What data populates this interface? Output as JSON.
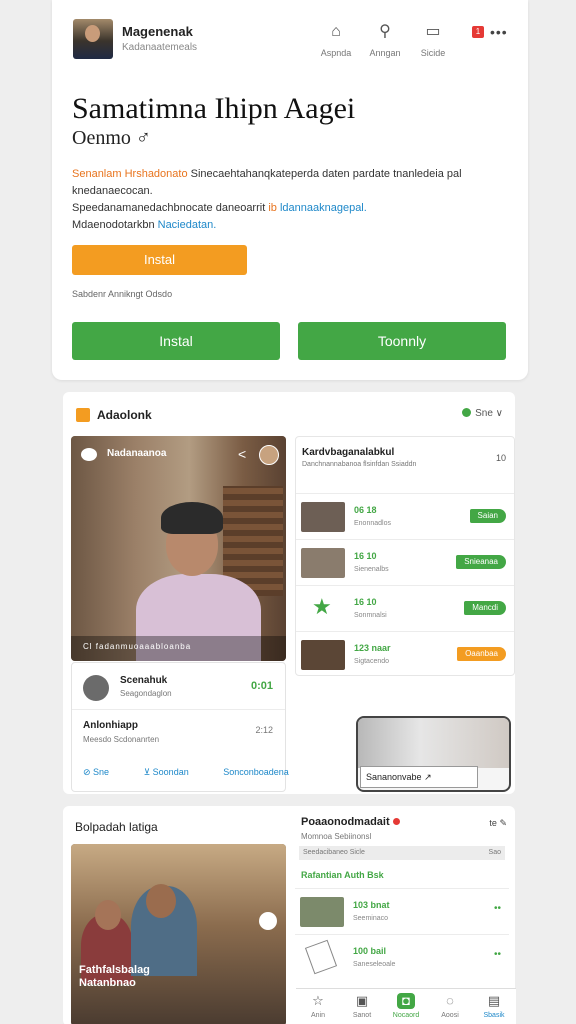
{
  "header": {
    "app_name": "Magenenak",
    "app_sub": "Kadanaatemeals",
    "actions": [
      {
        "icon": "home-icon",
        "label": "Aspnda"
      },
      {
        "icon": "bookmark-icon",
        "label": "Anngan"
      },
      {
        "icon": "inbox-icon",
        "label": "Sicide"
      }
    ],
    "badge": "1"
  },
  "title": "Samatimna Ihipn Aagei",
  "subtitle": "Oenmo",
  "description": {
    "lead": "Senanlam Hrshadonato",
    "line1": "Sinecaehtahanqkateperda daten pardate tnanledeia pal",
    "line2": "knedanaecocan.",
    "line3_a": "Speedanamanedachbnocate daneoarrit",
    "line3_b": "ib",
    "line3_c": "ldannaaknagepal.",
    "line4_a": "Mdaenodotarkbn",
    "line4_b": "Naciedatan."
  },
  "install_orange": "Instal",
  "small_note": "Sabdenr Annikngt Odsdo",
  "buttons": {
    "left": "Instal",
    "right": "Toonnly"
  },
  "mid_panel": {
    "title": "Adaolonk",
    "tools": "Sne",
    "video": {
      "top_label": "Nadanaanoa",
      "bottom_text": "Cl  fadanmuoaaabloanba"
    },
    "info": {
      "name": "Scenahuk",
      "meta": "Seagondaglon",
      "green_num": "0:01",
      "h2": "Anlonhiapp",
      "sub2": "Meesdo Scdonanrten",
      "num2": "2:12",
      "links": [
        "Sne",
        "Soondan",
        "Sonconboadena"
      ]
    },
    "list": {
      "title": "Kardvbaganalabkul",
      "sub": "Danchnannabanoa flsinfdan Ssiaddn",
      "num": "10",
      "rows": [
        {
          "r1": "06  18",
          "r2": "Enonnadlos",
          "pill": "Saian",
          "pill_color": "green"
        },
        {
          "r1": "16  10",
          "r2": "Sienenalbs",
          "pill": "Snieanaa",
          "pill_color": "green"
        },
        {
          "r1": "16  10",
          "r2": "Sonmnalsi",
          "pill": "Mancdi",
          "pill_color": "green"
        },
        {
          "r1": "123 naar",
          "r2": "Sigtacendo",
          "pill": "Oaanbaa",
          "pill_color": "orange"
        }
      ]
    },
    "popup": {
      "caption": "Sananonvabe"
    }
  },
  "bottom_panel": {
    "title": "Bolpadah latiga",
    "photo_caption": "Fathfalsbalag\nNatanbnao",
    "right": {
      "title": "Poaaonodmadait",
      "tools": "te",
      "sub": "Momnoa Sebiinonsl",
      "gray_left": "Seedacibaneo Sicle",
      "gray_right": "Sao",
      "green_label": "Rafantian  Auth Bsk",
      "rows": [
        {
          "r1": "103 bnat",
          "r2": "Seeminaco"
        },
        {
          "r1": "100 bail",
          "r2": "Saneseleoale"
        }
      ]
    }
  },
  "navbar": [
    {
      "icon": "star-icon",
      "label": "Anin"
    },
    {
      "icon": "save-icon",
      "label": "Sanot"
    },
    {
      "icon": "bag-icon",
      "label": "Nocaord",
      "active": true
    },
    {
      "icon": "chat-icon",
      "label": "Aoosi"
    },
    {
      "icon": "card-icon",
      "label": "Sbasik"
    }
  ]
}
